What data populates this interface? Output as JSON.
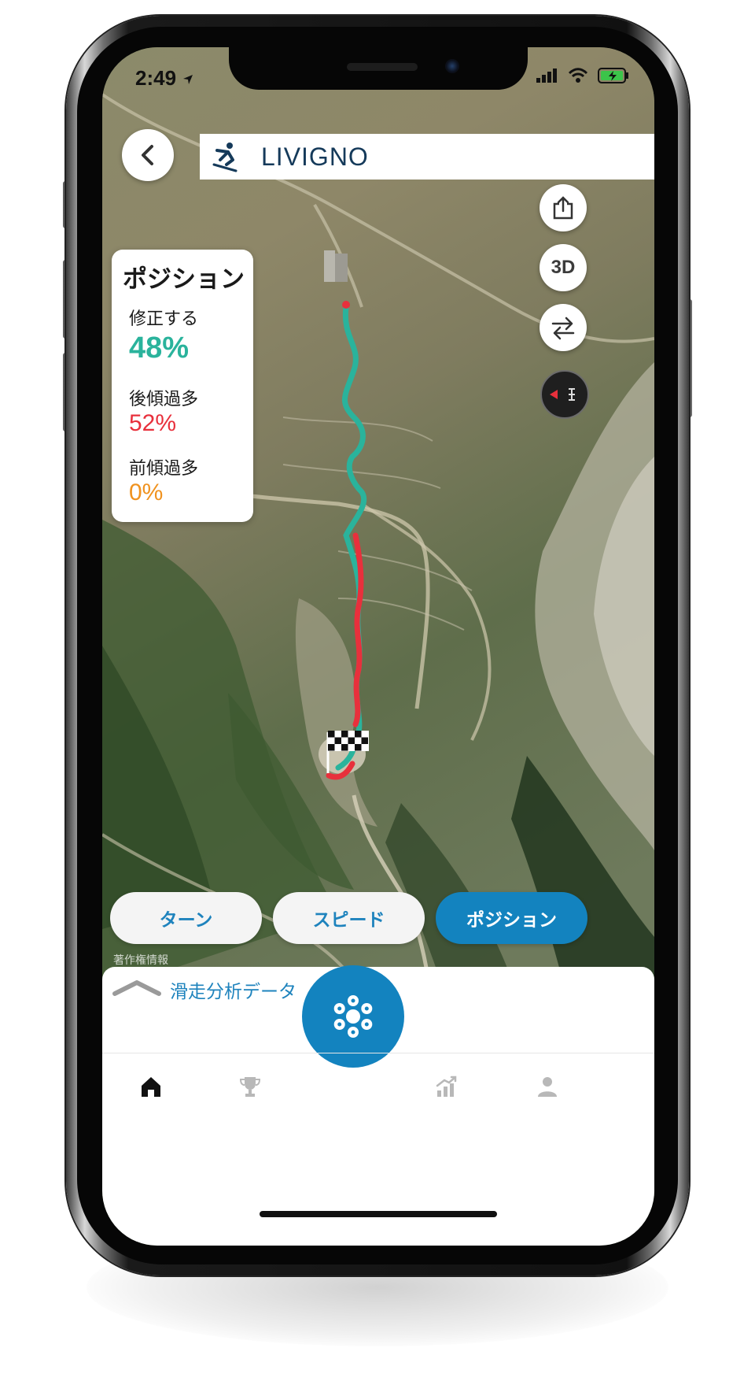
{
  "status_bar": {
    "time": "2:49"
  },
  "header": {
    "title": "LIVIGNO",
    "back_icon": "chevron-left-icon",
    "sport_icon": "skier-icon"
  },
  "map_controls": {
    "share_icon": "share-icon",
    "view_3d_label": "3D",
    "swap_icon": "swap-arrows-icon",
    "compass_icon": "compass-icon"
  },
  "position_panel": {
    "title": "ポジション",
    "stats": [
      {
        "label": "修正する",
        "value": "48%",
        "color": "#2ab39c"
      },
      {
        "label": "後傾過多",
        "value": "52%",
        "color": "#e8303c"
      },
      {
        "label": "前傾過多",
        "value": "0%",
        "color": "#f0921e"
      }
    ]
  },
  "mode_tabs": [
    {
      "label": "ターン",
      "active": false
    },
    {
      "label": "スピード",
      "active": false
    },
    {
      "label": "ポジション",
      "active": true
    }
  ],
  "map_copyright": "著作権情報",
  "bottom_sheet": {
    "label": "滑走分析データ",
    "handle_icon": "chevron-up-icon",
    "fab_icon": "snowflake-icon"
  },
  "bottom_nav": [
    {
      "name": "home",
      "icon": "home-icon",
      "active": true
    },
    {
      "name": "trophy",
      "icon": "trophy-icon",
      "active": false
    },
    {
      "name": "stats",
      "icon": "chart-icon",
      "active": false
    },
    {
      "name": "profile",
      "icon": "profile-icon",
      "active": false
    }
  ],
  "colors": {
    "teal": "#2ab39c",
    "red": "#e8303c",
    "orange": "#f0921e",
    "brand_blue": "#1383bf",
    "title_navy": "#153a5a"
  }
}
